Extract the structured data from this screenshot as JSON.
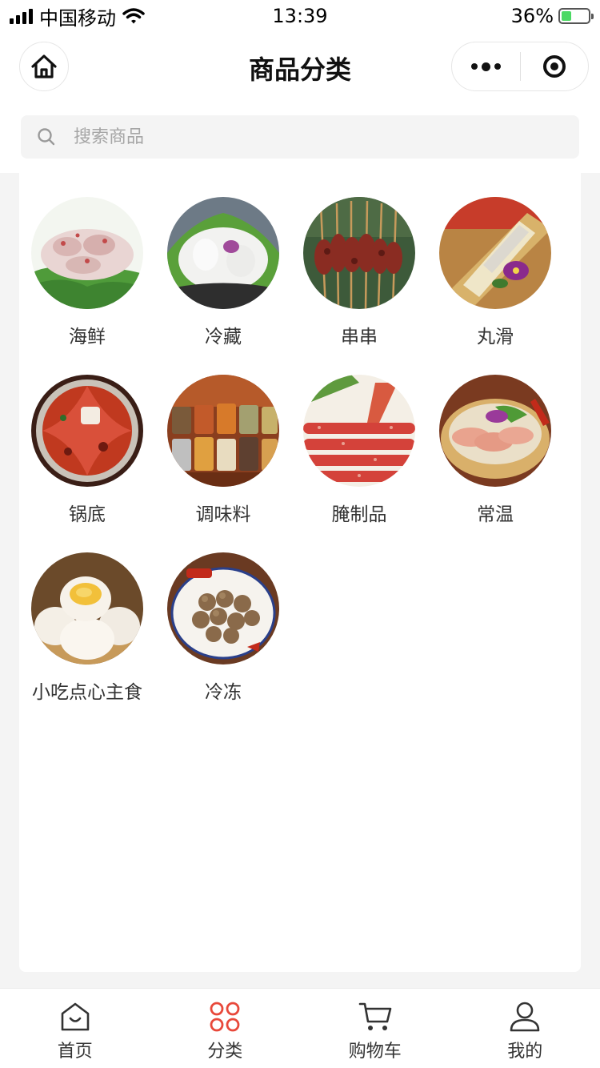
{
  "status_bar": {
    "carrier": "中国移动",
    "time": "13:39",
    "battery": "36%",
    "battery_level": 0.36
  },
  "nav": {
    "title": "商品分类"
  },
  "search": {
    "placeholder": "搜索商品"
  },
  "categories": [
    {
      "label": "海鲜",
      "icon": "seafood-image"
    },
    {
      "label": "冷藏",
      "icon": "chilled-image"
    },
    {
      "label": "串串",
      "icon": "skewers-image"
    },
    {
      "label": "丸滑",
      "icon": "paste-image"
    },
    {
      "label": "锅底",
      "icon": "hotpot-base-image"
    },
    {
      "label": "调味料",
      "icon": "seasoning-image"
    },
    {
      "label": "腌制品",
      "icon": "cured-meat-image"
    },
    {
      "label": "常温",
      "icon": "room-temp-image"
    },
    {
      "label": "小吃点心主食",
      "icon": "snack-image"
    },
    {
      "label": "冷冻",
      "icon": "frozen-image"
    }
  ],
  "tabbar": [
    {
      "label": "首页",
      "icon": "home-bag-icon"
    },
    {
      "label": "分类",
      "icon": "category-grid-icon",
      "active": true
    },
    {
      "label": "购物车",
      "icon": "cart-icon"
    },
    {
      "label": "我的",
      "icon": "user-icon"
    }
  ],
  "colors": {
    "accent": "#e8483a",
    "background": "#f4f4f4"
  }
}
